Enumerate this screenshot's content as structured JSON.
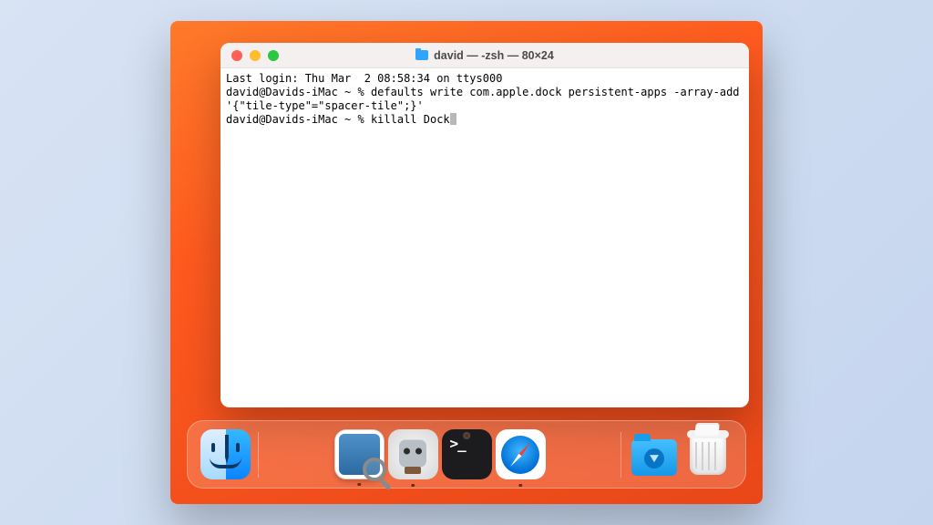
{
  "window": {
    "title": "david — -zsh — 80×24"
  },
  "terminal": {
    "line1": "Last login: Thu Mar  2 08:58:34 on ttys000",
    "line2": "david@Davids-iMac ~ % defaults write com.apple.dock persistent-apps -array-add '{\"tile-type\"=\"spacer-tile\";}'",
    "prompt2": "david@Davids-iMac ~ % ",
    "cmd2": "killall Dock"
  },
  "dock": {
    "finder": "Finder",
    "preview": "Preview",
    "automator": "Automator",
    "terminal": "Terminal",
    "safari": "Safari",
    "downloads": "Downloads",
    "trash": "Trash"
  }
}
